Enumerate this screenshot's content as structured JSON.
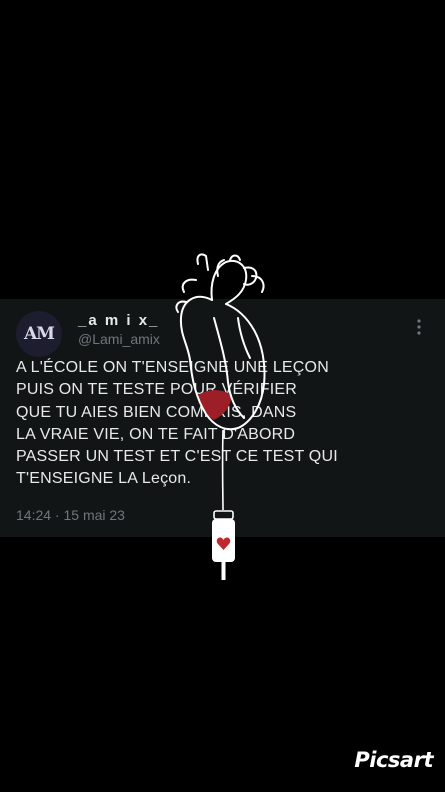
{
  "tweet": {
    "avatar_text": "AM",
    "display_name": "_a m i x_",
    "handle": "@Lami_amix",
    "text_lines": [
      "A L'ÉCOLE ON T'ENSEIGNE UNE LEÇON",
      "PUIS ON TE TESTE POUR VÉRIFIER",
      "QUE TU AIES BIEN COMPRIS, DANS",
      "LA VRAIE VIE, ON TE FAIT D'ABORD",
      "PASSER UN TEST ET C'EST CE TEST QUI",
      "T'ENSEIGNE LA Leçon."
    ],
    "timestamp": "14:24 · 15 mai 23",
    "more_icon": "more-options-icon"
  },
  "overlay": {
    "heart_icon": "anatomical-heart-icon",
    "blood_bag_icon": "blood-bag-icon",
    "heart_accent_color": "#c0282f"
  },
  "watermark": {
    "text": "Picsart"
  }
}
